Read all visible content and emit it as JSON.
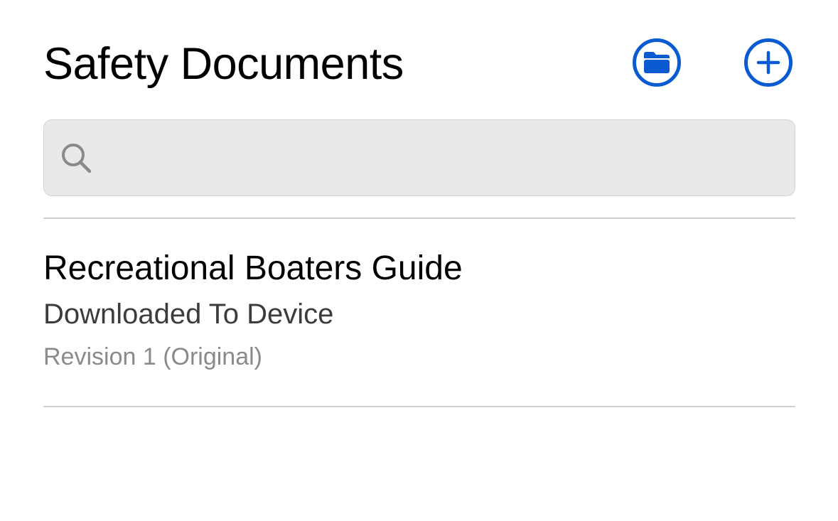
{
  "colors": {
    "accent": "#0a5bd1",
    "title_text": "#000000",
    "secondary_text": "#3c3c3e",
    "tertiary_text": "#8a8a8e",
    "search_background": "#e9e9ea"
  },
  "header": {
    "title": "Safety Documents",
    "folder_button_icon": "folder-icon",
    "add_button_icon": "plus-circle-icon"
  },
  "search": {
    "value": "",
    "placeholder": "",
    "icon": "magnifying-glass-icon"
  },
  "documents": [
    {
      "title": "Recreational Boaters Guide",
      "status": "Downloaded To Device",
      "revision": "Revision 1 (Original)"
    }
  ]
}
